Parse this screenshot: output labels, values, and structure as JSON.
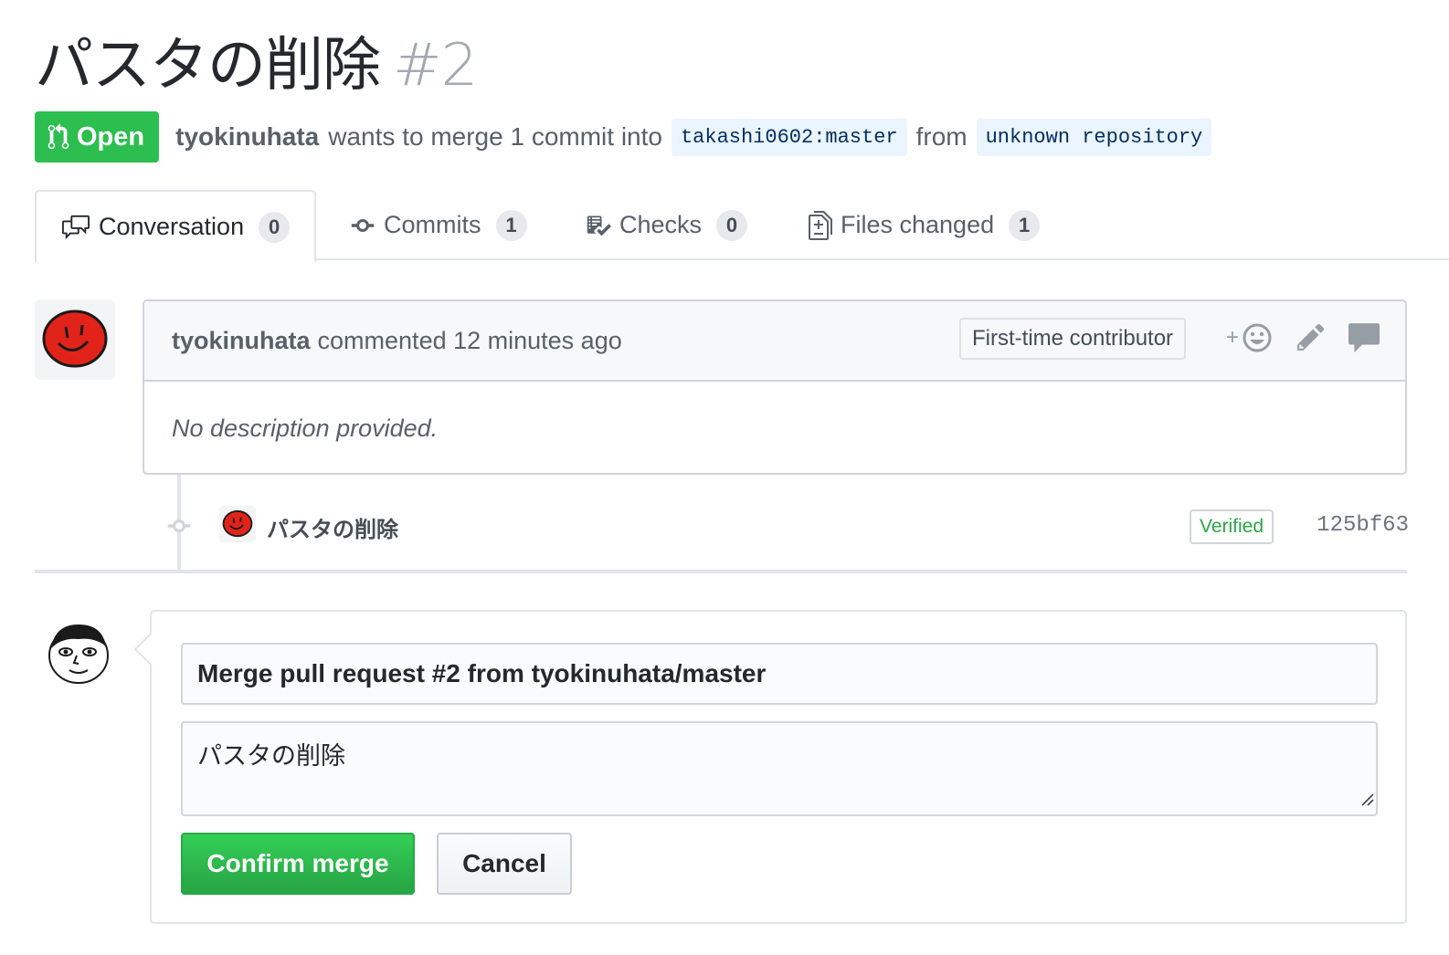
{
  "pr": {
    "title": "パスタの削除",
    "number": "#2",
    "state_label": "Open",
    "author": "tyokinuhata",
    "summary_text": "wants to merge 1 commit into",
    "base_branch": "takashi0602:master",
    "from_text": "from",
    "head_branch": "unknown repository"
  },
  "tabs": [
    {
      "label": "Conversation",
      "count": "0",
      "icon": "comment-discussion-icon"
    },
    {
      "label": "Commits",
      "count": "1",
      "icon": "git-commit-icon"
    },
    {
      "label": "Checks",
      "count": "0",
      "icon": "checklist-icon"
    },
    {
      "label": "Files changed",
      "count": "1",
      "icon": "diff-icon"
    }
  ],
  "comment": {
    "author": "tyokinuhata",
    "action": "commented 12 minutes ago",
    "contributor_label": "First-time contributor",
    "body": "No description provided."
  },
  "commit": {
    "message": "パスタの削除",
    "verified_label": "Verified",
    "sha": "125bf63"
  },
  "merge": {
    "title_value": "Merge pull request #2 from tyokinuhata/master",
    "message_value": "パスタの削除",
    "confirm_label": "Confirm merge",
    "cancel_label": "Cancel"
  },
  "colors": {
    "open_green": "#2cbe4e",
    "branch_bg": "#eaf5ff",
    "verified_green": "#28a745"
  }
}
